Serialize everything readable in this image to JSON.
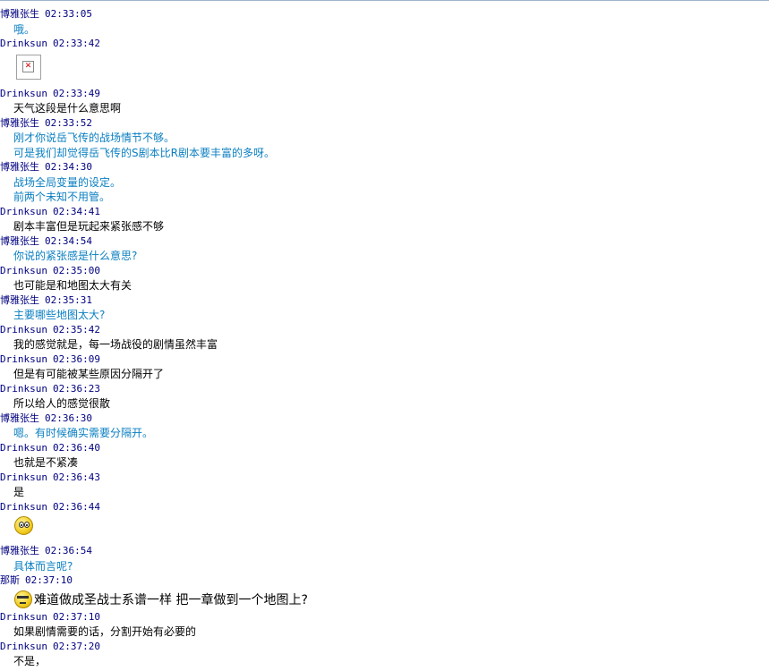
{
  "colors": {
    "header_name": "#000080",
    "reply_blue": "#0b7fc1",
    "text_black": "#000000"
  },
  "messages": [
    {
      "sender": "博雅张生",
      "time": "02:33:05",
      "lines": [
        "哦。"
      ],
      "color": "blue"
    },
    {
      "sender": "Drinksun",
      "time": "02:33:42",
      "image": "broken-image-icon"
    },
    {
      "sender": "Drinksun",
      "time": "02:33:49",
      "lines": [
        "天气这段是什么意思啊"
      ],
      "color": "black"
    },
    {
      "sender": "博雅张生",
      "time": "02:33:52",
      "lines": [
        "刚才你说岳飞传的战场情节不够。",
        "可是我们却觉得岳飞传的S剧本比R剧本要丰富的多呀。"
      ],
      "color": "blue"
    },
    {
      "sender": "博雅张生",
      "time": "02:34:30",
      "lines": [
        "战场全局变量的设定。",
        "前两个未知不用管。"
      ],
      "color": "blue"
    },
    {
      "sender": "Drinksun",
      "time": "02:34:41",
      "lines": [
        "剧本丰富但是玩起来紧张感不够"
      ],
      "color": "black"
    },
    {
      "sender": "博雅张生",
      "time": "02:34:54",
      "lines": [
        "你说的紧张感是什么意思?"
      ],
      "color": "blue"
    },
    {
      "sender": "Drinksun",
      "time": "02:35:00",
      "lines": [
        "也可能是和地图太大有关"
      ],
      "color": "black"
    },
    {
      "sender": "博雅张生",
      "time": "02:35:31",
      "lines": [
        "主要哪些地图太大?"
      ],
      "color": "blue"
    },
    {
      "sender": "Drinksun",
      "time": "02:35:42",
      "lines": [
        "我的感觉就是，每一场战役的剧情虽然丰富"
      ],
      "color": "black"
    },
    {
      "sender": "Drinksun",
      "time": "02:36:09",
      "lines": [
        "但是有可能被某些原因分隔开了"
      ],
      "color": "black"
    },
    {
      "sender": "Drinksun",
      "time": "02:36:23",
      "lines": [
        "所以给人的感觉很散"
      ],
      "color": "black"
    },
    {
      "sender": "博雅张生",
      "time": "02:36:30",
      "lines": [
        "嗯。有时候确实需要分隔开。"
      ],
      "color": "blue"
    },
    {
      "sender": "Drinksun",
      "time": "02:36:40",
      "lines": [
        "也就是不紧凑"
      ],
      "color": "black"
    },
    {
      "sender": "Drinksun",
      "time": "02:36:43",
      "lines": [
        "是"
      ],
      "color": "black"
    },
    {
      "sender": "Drinksun",
      "time": "02:36:44",
      "smiley": "smiley-face-icon"
    },
    {
      "sender": "博雅张生",
      "time": "02:36:54",
      "lines": [
        "具体而言呢?"
      ],
      "color": "blue"
    },
    {
      "sender": "那斯",
      "time": "02:37:10",
      "big": "难道做成圣战士系谱一样 把一章做到一个地图上?",
      "emoticon": "cool-face-icon"
    },
    {
      "sender": "Drinksun",
      "time": "02:37:10",
      "lines": [
        "如果剧情需要的话，分割开始有必要的"
      ],
      "color": "black"
    },
    {
      "sender": "Drinksun",
      "time": "02:37:20",
      "lines": [
        "不是，"
      ],
      "color": "black"
    }
  ]
}
